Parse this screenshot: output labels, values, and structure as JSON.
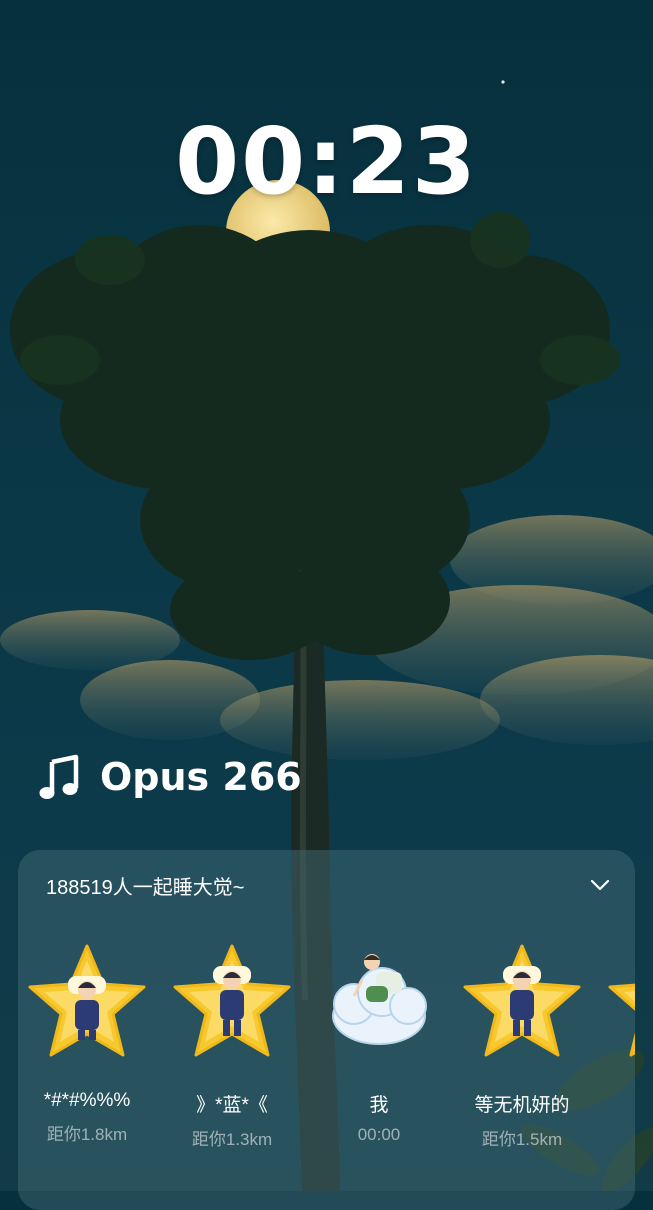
{
  "clock": {
    "time": "00:23"
  },
  "now_playing": {
    "icon": "music-note-icon",
    "title": "Opus 266"
  },
  "panel": {
    "count_text": "188519人一起睡大觉~",
    "toggle_icon": "chevron-down-icon",
    "users": [
      {
        "name": "*#*#%%%",
        "distance": "距你1.8km",
        "avatar": "star-sleeper-avatar"
      },
      {
        "name": "》*蓝*《",
        "distance": "距你1.3km",
        "avatar": "star-sleeper-avatar"
      },
      {
        "name": "我",
        "distance": "00:00",
        "avatar": "cloud-sleeper-avatar"
      },
      {
        "name": "等无机妍的",
        "distance": "距你1.5km",
        "avatar": "star-sleeper-avatar"
      },
      {
        "name": "",
        "distance": "距",
        "avatar": "star-sleeper-avatar"
      }
    ]
  },
  "colors": {
    "sky": "#0b3847",
    "moon": "#f0d78a",
    "star": "#f7c92e",
    "panel": "#4b737d"
  }
}
